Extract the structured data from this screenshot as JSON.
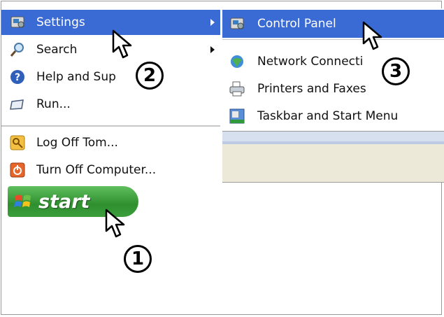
{
  "start_menu": {
    "items": [
      {
        "label": "Settings",
        "icon": "settings-icon",
        "submenu": true,
        "highlighted": true
      },
      {
        "label": "Search",
        "icon": "search-icon",
        "submenu": true
      },
      {
        "label": "Help and Sup",
        "icon": "help-icon"
      },
      {
        "label": "Run...",
        "icon": "run-icon"
      },
      {
        "label": "Log Off Tom...",
        "icon": "log-off-icon"
      },
      {
        "label": "Turn Off Computer...",
        "icon": "power-icon"
      }
    ]
  },
  "settings_submenu": {
    "items": [
      {
        "label": "Control Panel",
        "icon": "control-panel-icon",
        "highlighted": true
      },
      {
        "label": "Network Connecti",
        "icon": "network-icon"
      },
      {
        "label": "Printers and Faxes",
        "icon": "printer-icon"
      },
      {
        "label": "Taskbar and Start Menu",
        "icon": "taskbar-icon"
      }
    ]
  },
  "start_button": {
    "label": "start"
  },
  "annotations": {
    "step1": "1",
    "step2": "2",
    "step3": "3"
  },
  "colors": {
    "highlight": "#3a6bd4",
    "start_green": "#2f8f2f"
  }
}
